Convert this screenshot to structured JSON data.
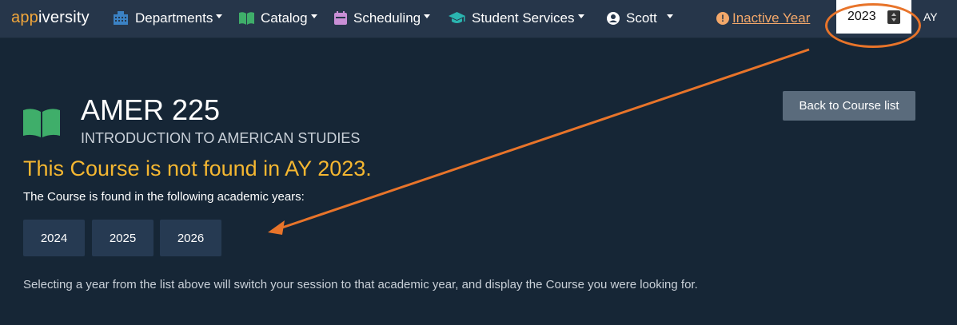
{
  "brand": {
    "part1": "app",
    "part2": "iversity"
  },
  "nav": {
    "departments": "Departments",
    "catalog": "Catalog",
    "scheduling": "Scheduling",
    "student_services": "Student Services",
    "user": "Scott"
  },
  "status": {
    "inactive_year": "Inactive Year"
  },
  "year_selector": {
    "value": "2023",
    "label": "AY"
  },
  "course": {
    "code": "AMER 225",
    "title": "INTRODUCTION TO AMERICAN STUDIES",
    "not_found": "This Course is not found in AY 2023.",
    "found_in_label": "The Course is found in the following academic years:",
    "years": [
      "2024",
      "2025",
      "2026"
    ],
    "help_text": "Selecting a year from the list above will switch your session to that academic year, and display the Course you were looking for."
  },
  "actions": {
    "back": "Back to Course list"
  },
  "colors": {
    "background": "#162636",
    "navbar": "#26364a",
    "brand_accent": "#f2a73b",
    "warning_text": "#f5b731",
    "inactive_link": "#f3a86a",
    "annotation": "#e8742a",
    "book_icon": "#3fae6a"
  },
  "icons": {
    "departments": "building-icon",
    "catalog": "book-icon",
    "scheduling": "calendar-icon",
    "student_services": "graduation-cap-icon",
    "user": "user-circle-icon",
    "warning": "exclamation-circle-icon"
  }
}
